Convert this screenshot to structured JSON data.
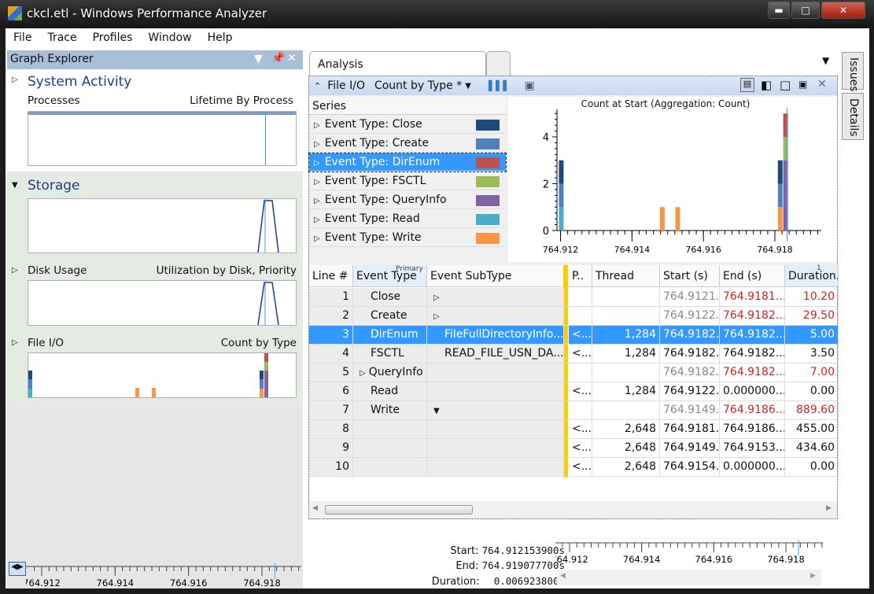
{
  "window": {
    "title": "ckcl.etl - Windows Performance Analyzer",
    "buttons": [
      "minimize",
      "maximize",
      "close"
    ]
  },
  "menu": [
    "File",
    "Trace",
    "Profiles",
    "Window",
    "Help"
  ],
  "graph_explorer": {
    "title": "Graph Explorer",
    "sections": [
      {
        "title": "System Activity",
        "graph": "Processes",
        "preset": "Lifetime By Process"
      },
      {
        "title": "Storage",
        "graphs": [
          {
            "graph": "Disk Usage",
            "preset": "Utilization by Disk, Priority"
          },
          {
            "graph": "File I/O",
            "preset": "Count by Type"
          }
        ]
      }
    ],
    "timeline_ticks": [
      "764.912",
      "764.914",
      "764.916",
      "764.918"
    ]
  },
  "analysis": {
    "tab": "Analysis",
    "panel": {
      "graph": "File I/O",
      "preset": "Count by Type *"
    },
    "series_header": "Series",
    "series": [
      {
        "label": "Event Type: Close",
        "color": "#1f497d"
      },
      {
        "label": "Event Type: Create",
        "color": "#4f81bd"
      },
      {
        "label": "Event Type: DirEnum",
        "color": "#c0504d",
        "selected": true
      },
      {
        "label": "Event Type: FSCTL",
        "color": "#9bbb59"
      },
      {
        "label": "Event Type: QueryInfo",
        "color": "#8064a2"
      },
      {
        "label": "Event Type: Read",
        "color": "#4bacc6"
      },
      {
        "label": "Event Type: Write",
        "color": "#f79646"
      }
    ],
    "table": {
      "columns": [
        "Line #",
        "Event Type",
        "Event SubType",
        "P..",
        "Thread",
        "Start (s)",
        "End (s)",
        "Duration..."
      ],
      "primary_label": "Primary",
      "sort_label": "1",
      "rows": [
        {
          "line": "1",
          "type": "Close",
          "sub": "",
          "p": "",
          "thread": "",
          "start": "764.9121...",
          "end": "764.9181...",
          "dur": "10.20",
          "expander": "collapsed",
          "agg": true
        },
        {
          "line": "2",
          "type": "Create",
          "sub": "",
          "p": "",
          "thread": "",
          "start": "764.9122...",
          "end": "764.9182...",
          "dur": "29.50",
          "expander": "collapsed",
          "agg": true
        },
        {
          "line": "3",
          "type": "DirEnum",
          "sub": "FileFullDirectoryInfo...",
          "p": "<...",
          "thread": "1,284",
          "start": "764.9182...",
          "end": "764.9182...",
          "dur": "5.00",
          "selected": true
        },
        {
          "line": "4",
          "type": "FSCTL",
          "sub": "READ_FILE_USN_DA...",
          "p": "<...",
          "thread": "1,284",
          "start": "764.9182...",
          "end": "764.9182...",
          "dur": "3.50"
        },
        {
          "line": "5",
          "type": "QueryInfo",
          "sub": "",
          "p": "",
          "thread": "",
          "start": "764.9182...",
          "end": "764.9182...",
          "dur": "7.00",
          "agg": true,
          "type_expander": "collapsed"
        },
        {
          "line": "6",
          "type": "Read",
          "sub": "",
          "p": "<...",
          "thread": "1,284",
          "start": "764.9122...",
          "end": "0.000000...",
          "dur": "0.00"
        },
        {
          "line": "7",
          "type": "Write",
          "sub": "",
          "p": "",
          "thread": "",
          "start": "764.9149...",
          "end": "764.9186...",
          "dur": "889.60",
          "expander": "expanded",
          "agg": true
        },
        {
          "line": "8",
          "type": "",
          "sub": "",
          "p": "<...",
          "thread": "2,648",
          "start": "764.9181...",
          "end": "764.9186...",
          "dur": "455.00"
        },
        {
          "line": "9",
          "type": "",
          "sub": "",
          "p": "<...",
          "thread": "2,648",
          "start": "764.9149...",
          "end": "764.9153...",
          "dur": "434.60"
        },
        {
          "line": "10",
          "type": "",
          "sub": "",
          "p": "<...",
          "thread": "2,648",
          "start": "764.9154...",
          "end": "0.000000...",
          "dur": "0.00"
        }
      ]
    },
    "selection": {
      "start_label": "Start:",
      "start": "764.912153900s",
      "end_label": "End:",
      "end": "764.919077700s",
      "duration_label": "Duration:",
      "duration": "0.006923800s"
    }
  },
  "side_tabs": [
    "Issues",
    "Details"
  ],
  "colors": {
    "accent": "#3399ff",
    "header": "#a9bed7",
    "cursor": "#ffcc00",
    "agg_red": "#cc2222"
  },
  "chart_data": {
    "type": "bar",
    "title": "Count at Start (Aggregation: Count)",
    "xlabel": "",
    "ylabel": "",
    "x_ticks": [
      "764.912",
      "764.914",
      "764.916",
      "764.918"
    ],
    "xlim": [
      764.9119,
      764.9193
    ],
    "ylim": [
      0,
      5
    ],
    "y_ticks": [
      0,
      2,
      4
    ],
    "stacks": [
      {
        "x": 764.91202,
        "segments": [
          {
            "series": "Read",
            "value": 1
          },
          {
            "series": "Create",
            "value": 1
          },
          {
            "series": "Close",
            "value": 1
          }
        ]
      },
      {
        "x": 764.91485,
        "segments": [
          {
            "series": "Write",
            "value": 1
          }
        ]
      },
      {
        "x": 764.91528,
        "segments": [
          {
            "series": "Write",
            "value": 1
          }
        ]
      },
      {
        "x": 764.91815,
        "segments": [
          {
            "series": "Write",
            "value": 1
          },
          {
            "series": "Create",
            "value": 1
          },
          {
            "series": "Close",
            "value": 1
          }
        ]
      },
      {
        "x": 764.9183,
        "segments": [
          {
            "series": "QueryInfo",
            "value": 3
          },
          {
            "series": "FSCTL",
            "value": 1
          },
          {
            "series": "DirEnum",
            "value": 1
          }
        ]
      }
    ]
  }
}
